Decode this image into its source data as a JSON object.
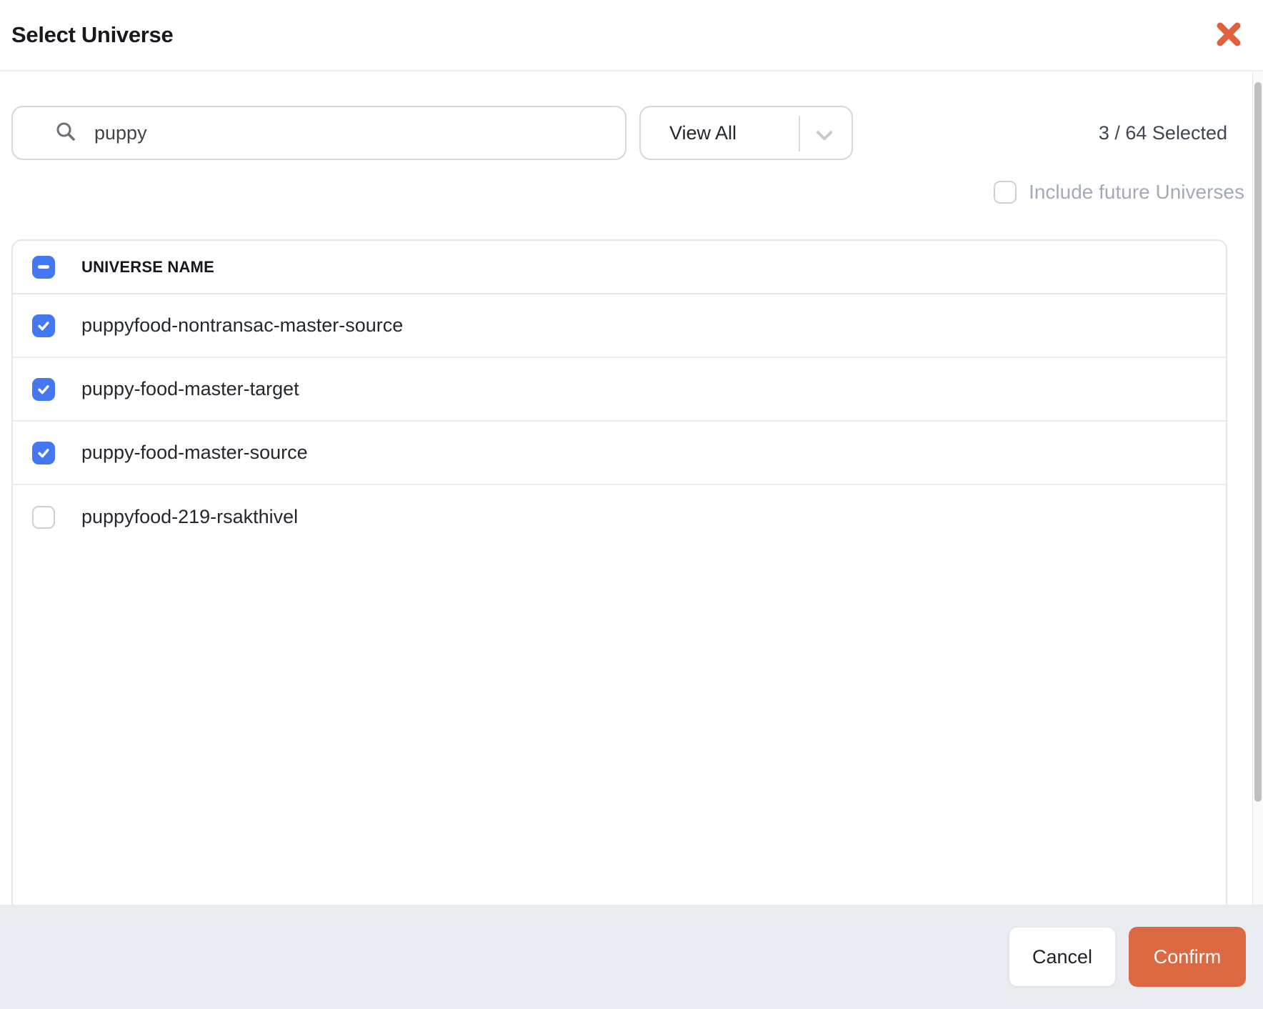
{
  "modal": {
    "title": "Select Universe"
  },
  "toolbar": {
    "search": {
      "value": "puppy",
      "placeholder": "Search"
    },
    "view_filter": {
      "value": "View All"
    },
    "selection_count": "3 / 64 Selected",
    "include_future": {
      "label": "Include future Universes",
      "checked": false
    }
  },
  "table": {
    "header": {
      "label": "UNIVERSE NAME",
      "select_all_state": "indeterminate"
    },
    "rows": [
      {
        "name": "puppyfood-nontransac-master-source",
        "checked": true
      },
      {
        "name": "puppy-food-master-target",
        "checked": true
      },
      {
        "name": "puppy-food-master-source",
        "checked": true
      },
      {
        "name": "puppyfood-219-rsakthivel",
        "checked": false
      }
    ]
  },
  "footer": {
    "cancel_label": "Cancel",
    "confirm_label": "Confirm"
  },
  "colors": {
    "checkbox_blue": "#4478F1",
    "close_orange": "#E2603C",
    "confirm_orange": "#DB6A42",
    "footer_bg": "#E9ECF1"
  }
}
